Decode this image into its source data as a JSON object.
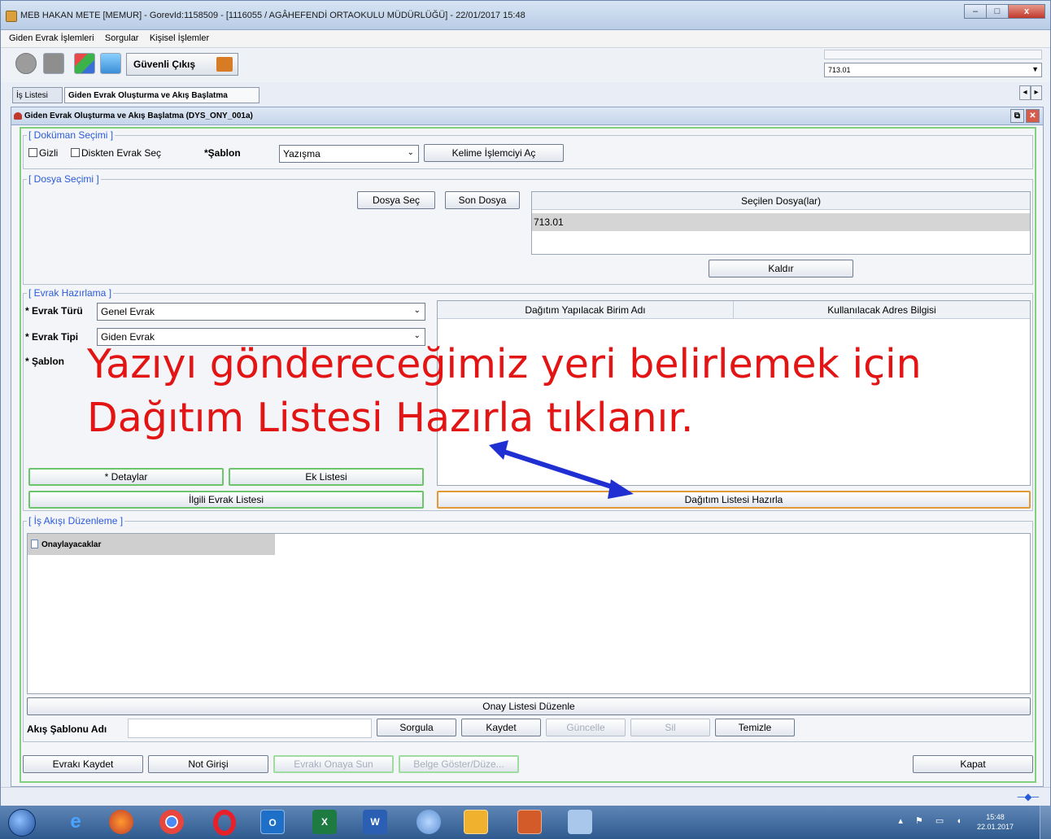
{
  "window": {
    "title": "MEB  HAKAN METE  [MEMUR] - GorevId:1158509 - [1116055 / AGÂHEFENDİ ORTAOKULU MÜDÜRLÜĞÜ] - 22/01/2017 15:48",
    "controls": {
      "minimize": "–",
      "maximize": "□",
      "close": "x"
    }
  },
  "menu": [
    "Giden Evrak İşlemleri",
    "Sorgular",
    "Kişisel İşlemler"
  ],
  "toolbar": {
    "safe_exit": "Güvenli Çıkış",
    "combo_value": "713.01"
  },
  "tabs": [
    "İş Listesi",
    "Giden Evrak Oluşturma ve Akış Başlatma"
  ],
  "form": {
    "title": "Giden Evrak Oluşturma ve Akış Başlatma (DYS_ONY_001a)",
    "doc_section": {
      "label": "[ Doküman Seçimi ]",
      "secret": "Gizli",
      "from_disk": "Diskten Evrak Seç",
      "template_label": "*Şablon",
      "template_value": "Yazışma",
      "word_button": "Kelime İşlemciyi Aç"
    },
    "file_section": {
      "label": "[ Dosya Seçimi ]",
      "select_button": "Dosya Seç",
      "last_button": "Son Dosya",
      "header": "Seçilen Dosya(lar)",
      "row": "713.01",
      "remove_button": "Kaldır"
    },
    "prep_section": {
      "label": "[ Evrak Hazırlama ]",
      "type_label": "* Evrak Türü",
      "type_value": "Genel Evrak",
      "kind_label": "* Evrak Tipi",
      "kind_value": "Giden Evrak",
      "template_label": "* Şablon",
      "details_button": "* Detaylar",
      "attachments_button": "Ek Listesi",
      "related_button": "İlgili Evrak Listesi",
      "col_unit": "Dağıtım Yapılacak Birim Adı",
      "col_address": "Kullanılacak Adres Bilgisi",
      "distribution_button": "Dağıtım Listesi Hazırla"
    },
    "flow_section": {
      "label": "[ İş Akışı Düzenleme ]",
      "tree_item": "Onaylayacaklar",
      "approval_button": "Onay Listesi Düzenle",
      "template_name_label": "Akış Şablonu Adı",
      "query": "Sorgula",
      "save": "Kaydet",
      "update": "Güncelle",
      "delete": "Sil",
      "clear": "Temizle"
    },
    "bottom": {
      "save_doc": "Evrakı Kaydet",
      "note": "Not Girişi",
      "submit": "Evrakı Onaya Sun",
      "show": "Belge Göster/Düze...",
      "close": "Kapat"
    }
  },
  "annotation": {
    "line1": "Yazıyı göndereceğimiz yeri belirlemek için",
    "line2": "Dağıtım Listesi Hazırla tıklanır.",
    "color": "#e31414",
    "arrow_color": "#1f2fd1"
  },
  "taskbar": {
    "time": "15:48",
    "date": "22.01.2017",
    "outlook": "O",
    "excel": "X",
    "word": "W"
  }
}
